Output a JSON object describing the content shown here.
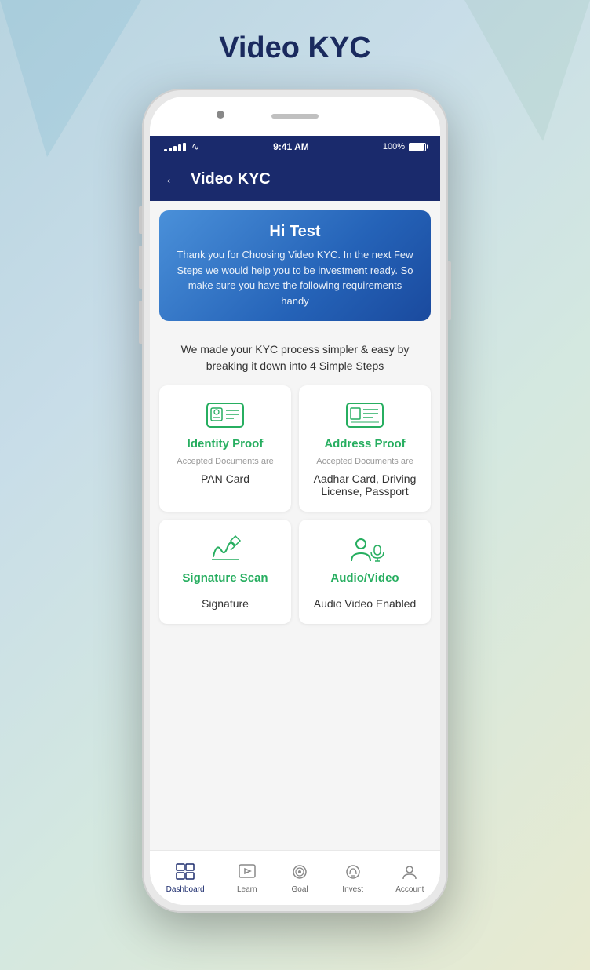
{
  "page": {
    "title": "Video KYC",
    "background_gradient": "linear-gradient(135deg, #b8d4e0 0%, #c8dde8 30%, #d4e8e0 60%, #e8ead0 100%)"
  },
  "status_bar": {
    "time": "9:41 AM",
    "battery": "100%",
    "signal": "•••••"
  },
  "header": {
    "title": "Video KYC",
    "back_label": "←"
  },
  "welcome": {
    "greeting": "Hi Test",
    "message": "Thank you for Choosing Video KYC. In the next Few Steps we would help you to be investment ready. So make sure you have the following requirements handy"
  },
  "steps_description": "We made your KYC process simpler & easy by breaking it down into 4 Simple Steps",
  "cards": [
    {
      "id": "identity-proof",
      "title": "Identity Proof",
      "sub": "Accepted Documents are",
      "value": "PAN Card",
      "icon": "id-card-icon"
    },
    {
      "id": "address-proof",
      "title": "Address Proof",
      "sub": "Accepted Documents are",
      "value": "Aadhar Card, Driving License, Passport",
      "icon": "address-card-icon"
    },
    {
      "id": "signature-scan",
      "title": "Signature Scan",
      "sub": "",
      "value": "Signature",
      "icon": "signature-icon"
    },
    {
      "id": "audio-video",
      "title": "Audio/Video",
      "sub": "",
      "value": "Audio Video Enabled",
      "icon": "video-icon"
    }
  ],
  "bottom_nav": [
    {
      "id": "dashboard",
      "label": "Dashboard",
      "icon": "dashboard-icon",
      "active": true
    },
    {
      "id": "learn",
      "label": "Learn",
      "icon": "learn-icon",
      "active": false
    },
    {
      "id": "goal",
      "label": "Goal",
      "icon": "goal-icon",
      "active": false
    },
    {
      "id": "invest",
      "label": "Invest",
      "icon": "invest-icon",
      "active": false
    },
    {
      "id": "account",
      "label": "Account",
      "icon": "account-icon",
      "active": false
    }
  ]
}
